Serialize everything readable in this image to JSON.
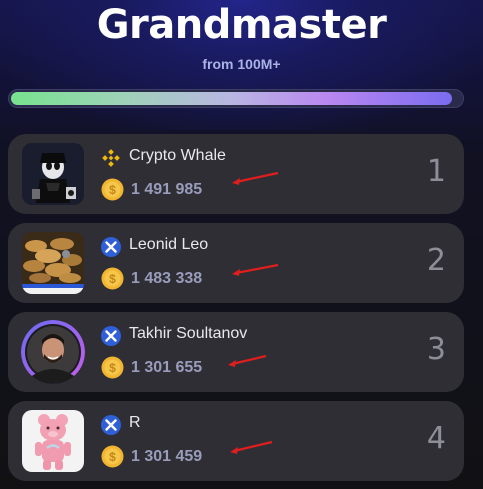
{
  "header": {
    "title": "Grandmaster",
    "subtitle": "from 100M+"
  },
  "progress": {
    "fraction": 0.98
  },
  "colors": {
    "accent_red_arrow": "#e01e1e",
    "coin_gold": "#f2b530",
    "score_text": "#9a9cbc"
  },
  "leaderboard": [
    {
      "name": "Crypto Whale",
      "score": "1 491 985",
      "rank": "1",
      "badge_icon": "binance-icon",
      "avatar": "skeleton-avatar"
    },
    {
      "name": "Leonid Leo",
      "score": "1 483 338",
      "rank": "2",
      "badge_icon": "x-logo-icon",
      "avatar": "coins-pile-avatar"
    },
    {
      "name": "Takhir Soultanov",
      "score": "1 301 655",
      "rank": "3",
      "badge_icon": "x-logo-icon",
      "avatar": "man-portrait-avatar"
    },
    {
      "name": "R",
      "score": "1 301 459",
      "rank": "4",
      "badge_icon": "x-logo-icon",
      "avatar": "pink-bear-avatar"
    }
  ]
}
